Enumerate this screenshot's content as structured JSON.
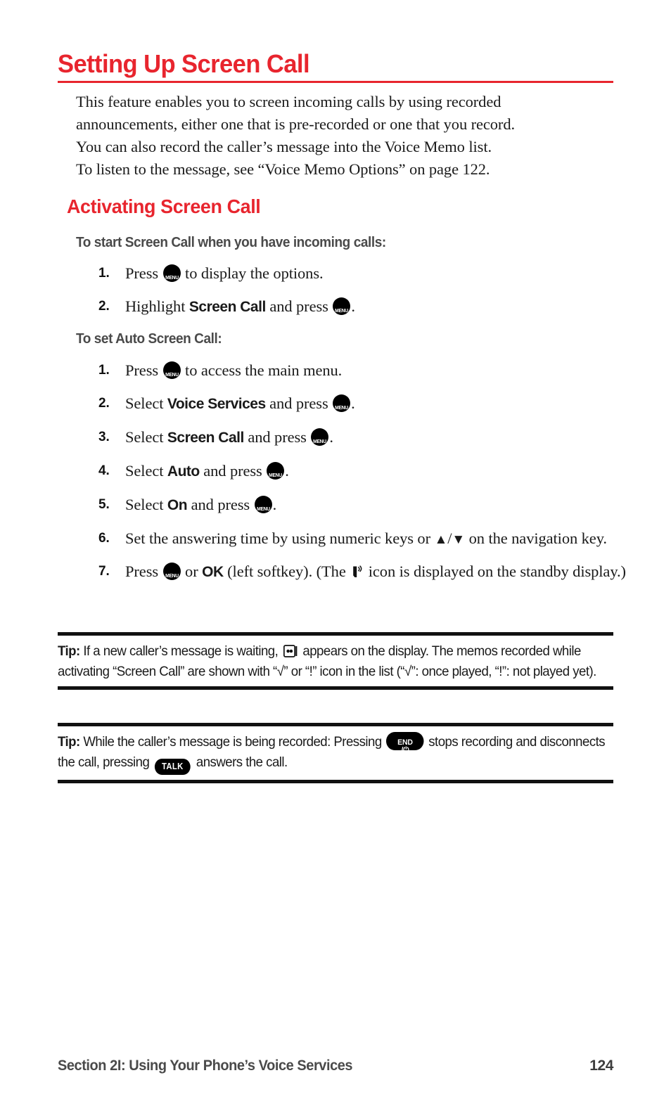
{
  "document": {
    "title": "Setting Up Screen Call",
    "accent_color": "#e8252e",
    "intro_lines": [
      "This feature enables you to screen incoming calls by using recorded",
      "announcements, either one that is pre-recorded or one that you record.",
      "You can also record the caller’s message into the Voice Memo list.",
      "To listen to the message, see “Voice Memo Options” on page 122."
    ],
    "section_heading": "Activating Screen Call"
  },
  "procedure_1": {
    "lead_in": "To start Screen Call when you have incoming calls:",
    "steps": [
      {
        "num": "1.",
        "parts": [
          {
            "t": "text",
            "v": "Press "
          },
          {
            "t": "key-menu",
            "v": "MENU OK"
          },
          {
            "t": "text",
            "v": " to display the options."
          }
        ]
      },
      {
        "num": "2.",
        "parts": [
          {
            "t": "text",
            "v": "Highlight "
          },
          {
            "t": "bold",
            "v": "Screen Call"
          },
          {
            "t": "text",
            "v": " and press "
          },
          {
            "t": "key-menu",
            "v": "MENU OK"
          },
          {
            "t": "text",
            "v": "."
          }
        ]
      }
    ]
  },
  "procedure_2": {
    "lead_in": "To set Auto Screen Call:",
    "steps": [
      {
        "num": "1.",
        "parts": [
          {
            "t": "text",
            "v": "Press "
          },
          {
            "t": "key-menu",
            "v": "MENU OK"
          },
          {
            "t": "text",
            "v": " to access the main menu."
          }
        ]
      },
      {
        "num": "2.",
        "parts": [
          {
            "t": "text",
            "v": "Select "
          },
          {
            "t": "bold",
            "v": "Voice Services"
          },
          {
            "t": "text",
            "v": " and press "
          },
          {
            "t": "key-menu",
            "v": "MENU OK"
          },
          {
            "t": "text",
            "v": "."
          }
        ]
      },
      {
        "num": "3.",
        "parts": [
          {
            "t": "text",
            "v": "Select "
          },
          {
            "t": "bold",
            "v": "Screen Call"
          },
          {
            "t": "text",
            "v": " and press "
          },
          {
            "t": "key-menu",
            "v": "MENU OK"
          },
          {
            "t": "text",
            "v": "."
          }
        ]
      },
      {
        "num": "4.",
        "parts": [
          {
            "t": "text",
            "v": "Select "
          },
          {
            "t": "bold",
            "v": "Auto"
          },
          {
            "t": "text",
            "v": " and press "
          },
          {
            "t": "key-menu",
            "v": "MENU OK"
          },
          {
            "t": "text",
            "v": "."
          }
        ]
      },
      {
        "num": "5.",
        "parts": [
          {
            "t": "text",
            "v": "Select "
          },
          {
            "t": "bold",
            "v": "On"
          },
          {
            "t": "text",
            "v": " and press "
          },
          {
            "t": "key-menu",
            "v": "MENU OK"
          },
          {
            "t": "text",
            "v": "."
          }
        ]
      },
      {
        "num": "6.",
        "parts": [
          {
            "t": "text",
            "v": "Set the answering time by using numeric keys or "
          },
          {
            "t": "tri-up",
            "v": "▲"
          },
          {
            "t": "text",
            "v": "/"
          },
          {
            "t": "tri-down",
            "v": "▼"
          },
          {
            "t": "text",
            "v": " on the navigation key."
          }
        ]
      },
      {
        "num": "7.",
        "parts": [
          {
            "t": "text",
            "v": "Press "
          },
          {
            "t": "key-menu",
            "v": "MENU OK"
          },
          {
            "t": "text",
            "v": " or "
          },
          {
            "t": "bold",
            "v": "OK"
          },
          {
            "t": "text",
            "v": " (left softkey). (The "
          },
          {
            "t": "icon-screencall",
            "v": "screen-call-icon"
          },
          {
            "t": "text",
            "v": " icon is displayed on the standby display.)"
          }
        ]
      }
    ]
  },
  "tips": [
    {
      "label": "Tip:",
      "parts": [
        {
          "t": "text",
          "v": " If a new caller’s message is waiting, "
        },
        {
          "t": "icon-msgbox",
          "v": "message-waiting-icon"
        },
        {
          "t": "text",
          "v": " appears on the display. The memos recorded while activating “Screen Call” are shown with “√” or “!” icon in the list (“√”: once played, “!”: not played yet)."
        }
      ]
    },
    {
      "label": "Tip:",
      "parts": [
        {
          "t": "text",
          "v": " While the caller’s message is being recorded: Pressing "
        },
        {
          "t": "key-end",
          "v": "END /power"
        },
        {
          "t": "text",
          "v": " stops recording and disconnects the call, pressing "
        },
        {
          "t": "key-talk",
          "v": "TALK"
        },
        {
          "t": "text",
          "v": " answers the call."
        }
      ]
    }
  ],
  "keys": {
    "menu_line1": "MENU",
    "menu_line2": "OK",
    "end_line1": "END",
    "end_line2": "/⏻",
    "talk_label": "TALK"
  },
  "footer": {
    "section_label": "Section 2I: Using Your Phone’s Voice Services",
    "page_number": "124"
  }
}
